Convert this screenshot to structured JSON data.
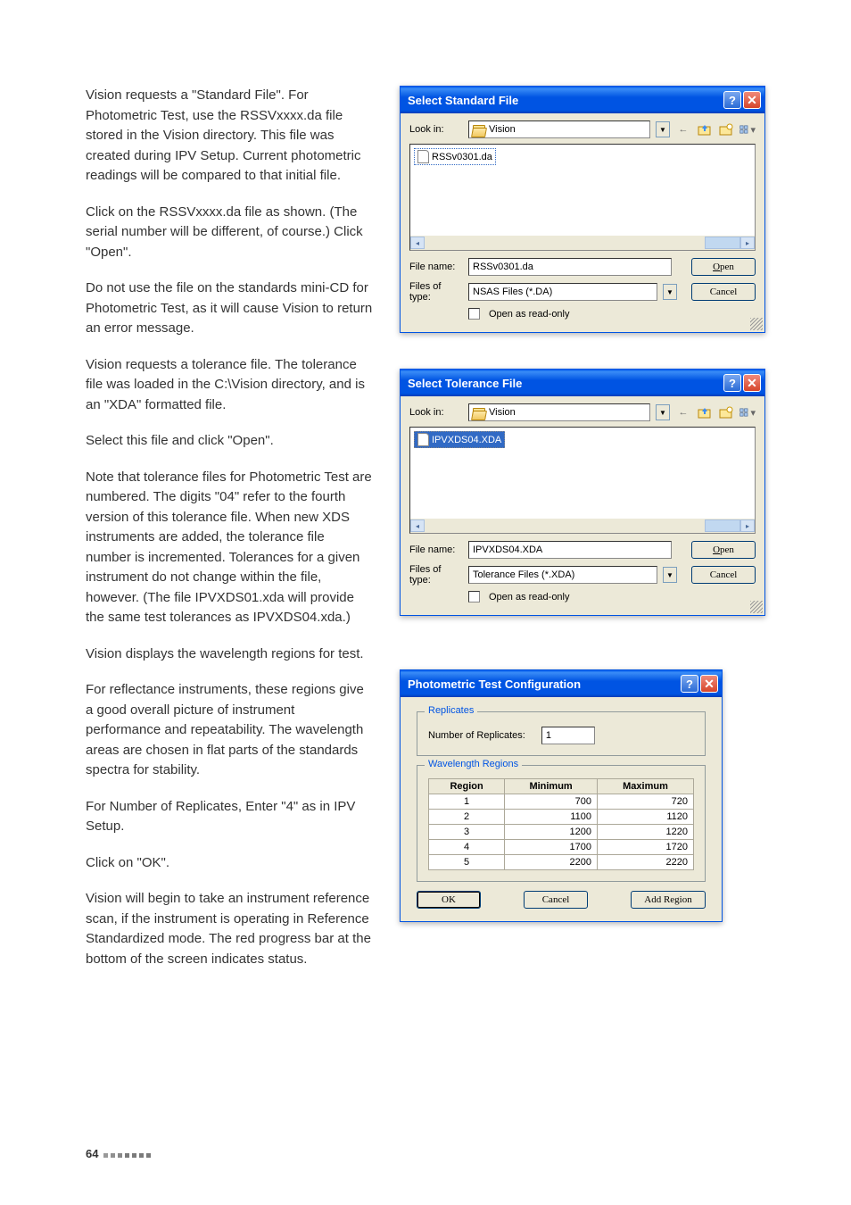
{
  "page_number": "64",
  "text": {
    "p1": "Vision requests a \"Standard File\". For Photometric Test, use the RSSVxxxx.da file stored in the Vision directory. This file was created during IPV Setup. Current photometric readings will be compared to that initial file.",
    "p2": "Click on the RSSVxxxx.da file as shown. (The serial number will be different, of course.) Click \"Open\".",
    "p3": "Do not use the file on the standards mini-CD for Photometric Test, as it will cause Vision to return an error message.",
    "p4": "Vision requests a tolerance file. The tolerance file was loaded in the C:\\Vision directory, and is an \"XDA\" formatted file.",
    "p5": "Select this file and click \"Open\".",
    "p6": "Note that tolerance files for Photometric Test are numbered. The digits \"04\" refer to the fourth version of this tolerance file. When new XDS instruments are added, the tolerance file number is incremented. Tolerances for a given instrument do not change within the file, however. (The file IPVXDS01.xda will provide the same test tolerances as IPVXDS04.xda.)",
    "p7": "Vision displays the wavelength regions for test.",
    "p8": "For reflectance instruments, these regions give a good overall picture of instrument performance and repeatability. The wavelength areas are chosen in flat parts of the standards spectra for stability.",
    "p9": "For Number of Replicates, Enter \"4\" as in IPV Setup.",
    "p10": "Click on \"OK\".",
    "p11": "Vision will begin to take an instrument reference scan, if the instrument is operating in Reference Standardized mode. The red progress bar at the bottom of the screen indicates status."
  },
  "dlg1": {
    "title": "Select Standard File",
    "look_in_label": "Look in:",
    "look_in_value": "Vision",
    "file_list_item": "RSSv0301.da",
    "filename_label": "File name:",
    "filename_value": "RSSv0301.da",
    "filetype_label": "Files of type:",
    "filetype_value": "NSAS Files (*.DA)",
    "readonly_label": "Open as read-only",
    "open": "Open",
    "cancel": "Cancel"
  },
  "dlg2": {
    "title": "Select Tolerance File",
    "look_in_label": "Look in:",
    "look_in_value": "Vision",
    "file_list_item": "IPVXDS04.XDA",
    "filename_label": "File name:",
    "filename_value": "IPVXDS04.XDA",
    "filetype_label": "Files of type:",
    "filetype_value": "Tolerance Files (*.XDA)",
    "readonly_label": "Open as read-only",
    "open": "Open",
    "cancel": "Cancel"
  },
  "dlg3": {
    "title": "Photometric Test Configuration",
    "replicates_legend": "Replicates",
    "replicates_label": "Number of Replicates:",
    "replicates_value": "1",
    "regions_legend": "Wavelength Regions",
    "ok": "OK",
    "cancel": "Cancel",
    "add_region": "Add Region",
    "table": {
      "headers": [
        "Region",
        "Minimum",
        "Maximum"
      ],
      "rows": [
        [
          "1",
          "700",
          "720"
        ],
        [
          "2",
          "1100",
          "1120"
        ],
        [
          "3",
          "1200",
          "1220"
        ],
        [
          "4",
          "1700",
          "1720"
        ],
        [
          "5",
          "2200",
          "2220"
        ]
      ]
    }
  },
  "chart_data": {
    "type": "table",
    "title": "Wavelength Regions",
    "columns": [
      "Region",
      "Minimum",
      "Maximum"
    ],
    "rows": [
      [
        1,
        700,
        720
      ],
      [
        2,
        1100,
        1120
      ],
      [
        3,
        1200,
        1220
      ],
      [
        4,
        1700,
        1720
      ],
      [
        5,
        2200,
        2220
      ]
    ]
  }
}
